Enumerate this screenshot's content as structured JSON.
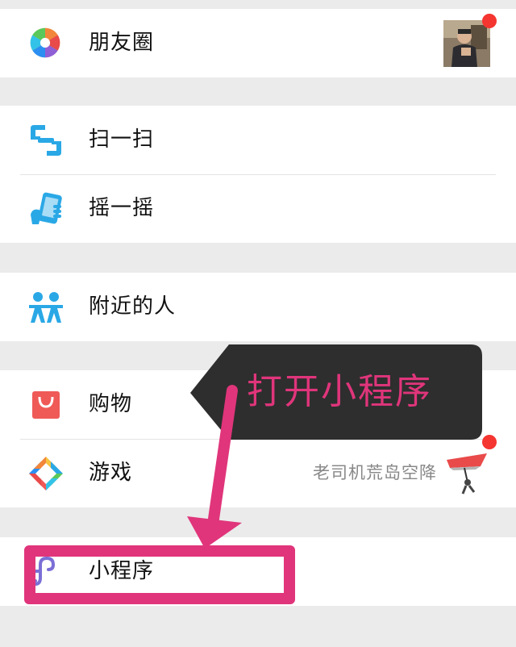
{
  "menu": {
    "moments": {
      "label": "朋友圈",
      "icon": "moments-aperture-icon"
    },
    "scan": {
      "label": "扫一扫",
      "icon": "scan-icon"
    },
    "shake": {
      "label": "摇一摇",
      "icon": "shake-phone-icon"
    },
    "nearby": {
      "label": "附近的人",
      "icon": "nearby-people-icon"
    },
    "shopping": {
      "label": "购物",
      "icon": "shopping-bag-icon"
    },
    "games": {
      "label": "游戏",
      "icon": "games-icon",
      "promo": "老司机荒岛空降"
    },
    "mini_programs": {
      "label": "小程序",
      "icon": "mini-program-icon"
    }
  },
  "annotation": {
    "tooltip_text": "打开小程序",
    "accent_color": "#e0357b"
  },
  "colors": {
    "background": "#ebebeb",
    "badge_dot": "#f43530",
    "icon_blue": "#2aa8e6"
  }
}
